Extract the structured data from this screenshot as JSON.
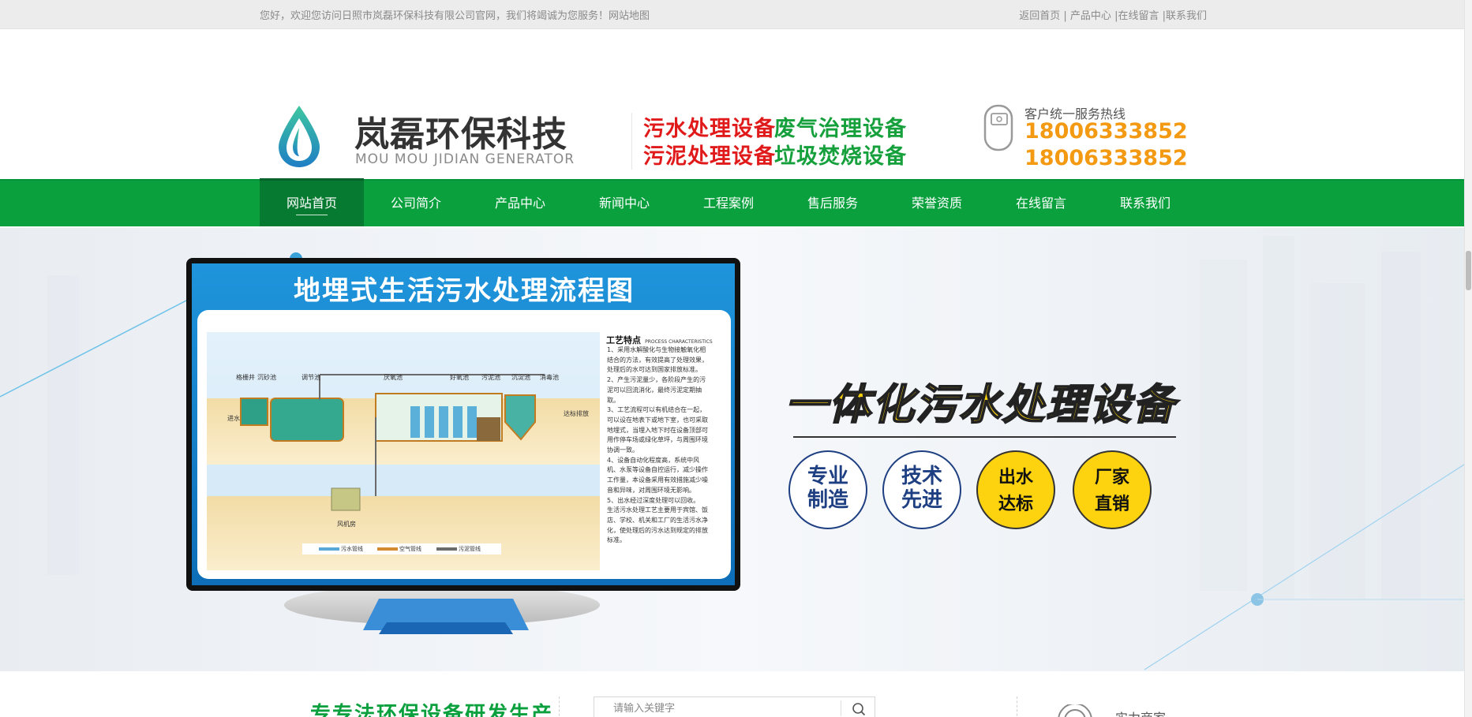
{
  "topbar": {
    "welcome": "您好，欢迎您访问日照市岚磊环保科技有限公司官网，我们将竭诚为您服务！网站地图",
    "links": [
      "返回首页",
      "产品中心",
      "在线留言",
      "联系我们"
    ],
    "separator": " |"
  },
  "header": {
    "brand_cn": "岚磊环保科技",
    "brand_en": "MOU MOU JIDIAN GENERATOR",
    "products": [
      {
        "label": "污水处理设备",
        "color": "#e01a1a"
      },
      {
        "label": "废气治理设备",
        "color": "#15a03c"
      },
      {
        "label": "污泥处理设备",
        "color": "#e01a1a"
      },
      {
        "label": "垃圾焚烧设备",
        "color": "#15a03c"
      }
    ],
    "hotline_label": "客户统一服务热线",
    "hotlines": [
      "18006333852",
      "18006333852"
    ],
    "accent_orange": "#f39a12"
  },
  "nav": {
    "items": [
      "网站首页",
      "公司简介",
      "产品中心",
      "新闻中心",
      "工程案例",
      "售后服务",
      "荣誉资质",
      "在线留言",
      "联系我们"
    ],
    "active_index": 0,
    "color": "#0aa03e"
  },
  "banner": {
    "screen_title": "地埋式生活污水处理流程图",
    "diagram_labels": [
      "格栅井",
      "沉砂池",
      "调节池",
      "厌氧池",
      "好氧池",
      "污泥池",
      "沉淀池",
      "消毒池",
      "进水",
      "达标排放",
      "风机房"
    ],
    "legend": [
      "污水管线",
      "空气管线",
      "污泥管线"
    ],
    "process_title": "工艺特点",
    "process_title_en": "PROCESS CHARACTERISTICS",
    "process_text": [
      "1、采用水解酸化与生物接触氧化相",
      "结合的方法，有效提高了处理效果，",
      "处理后的水可达到国家排放标准。",
      "2、产生污泥量少，各阶段产生的污",
      "泥可以回流消化，最终污泥定期抽",
      "取。",
      "3、工艺流程可以有机结合在一起，",
      "可以设在地表下或地下室，也可采取",
      "地埋式，当埋入地下时在设备顶部可",
      "用作停车场或绿化草坪，与周围环境",
      "协调一致。",
      "4、设备自动化程度高，系统中风",
      "机、水泵等设备自控运行，减少操作",
      "工作量，本设备采用有效措施减少噪",
      "音和异味，对周围环境无影响。",
      "5、出水经过深度处理可以回收。",
      "生活污水处理工艺主要用于宾馆、饭",
      "店、学校、机关和工厂的生活污水净",
      "化，使处理后的污水达到规定的排放",
      "标准。"
    ],
    "headline": "一体化污水处理设备",
    "badges": [
      {
        "l1": "专业",
        "l2": "制造"
      },
      {
        "l1": "技术",
        "l2": "先进"
      },
      {
        "l1": "出水",
        "l2": "达标"
      },
      {
        "l1": "厂家",
        "l2": "直销"
      }
    ]
  },
  "bottom": {
    "title": "专专法环保设备研发生产",
    "search_placeholder": "请输入关键字",
    "strength": "实力商家"
  }
}
